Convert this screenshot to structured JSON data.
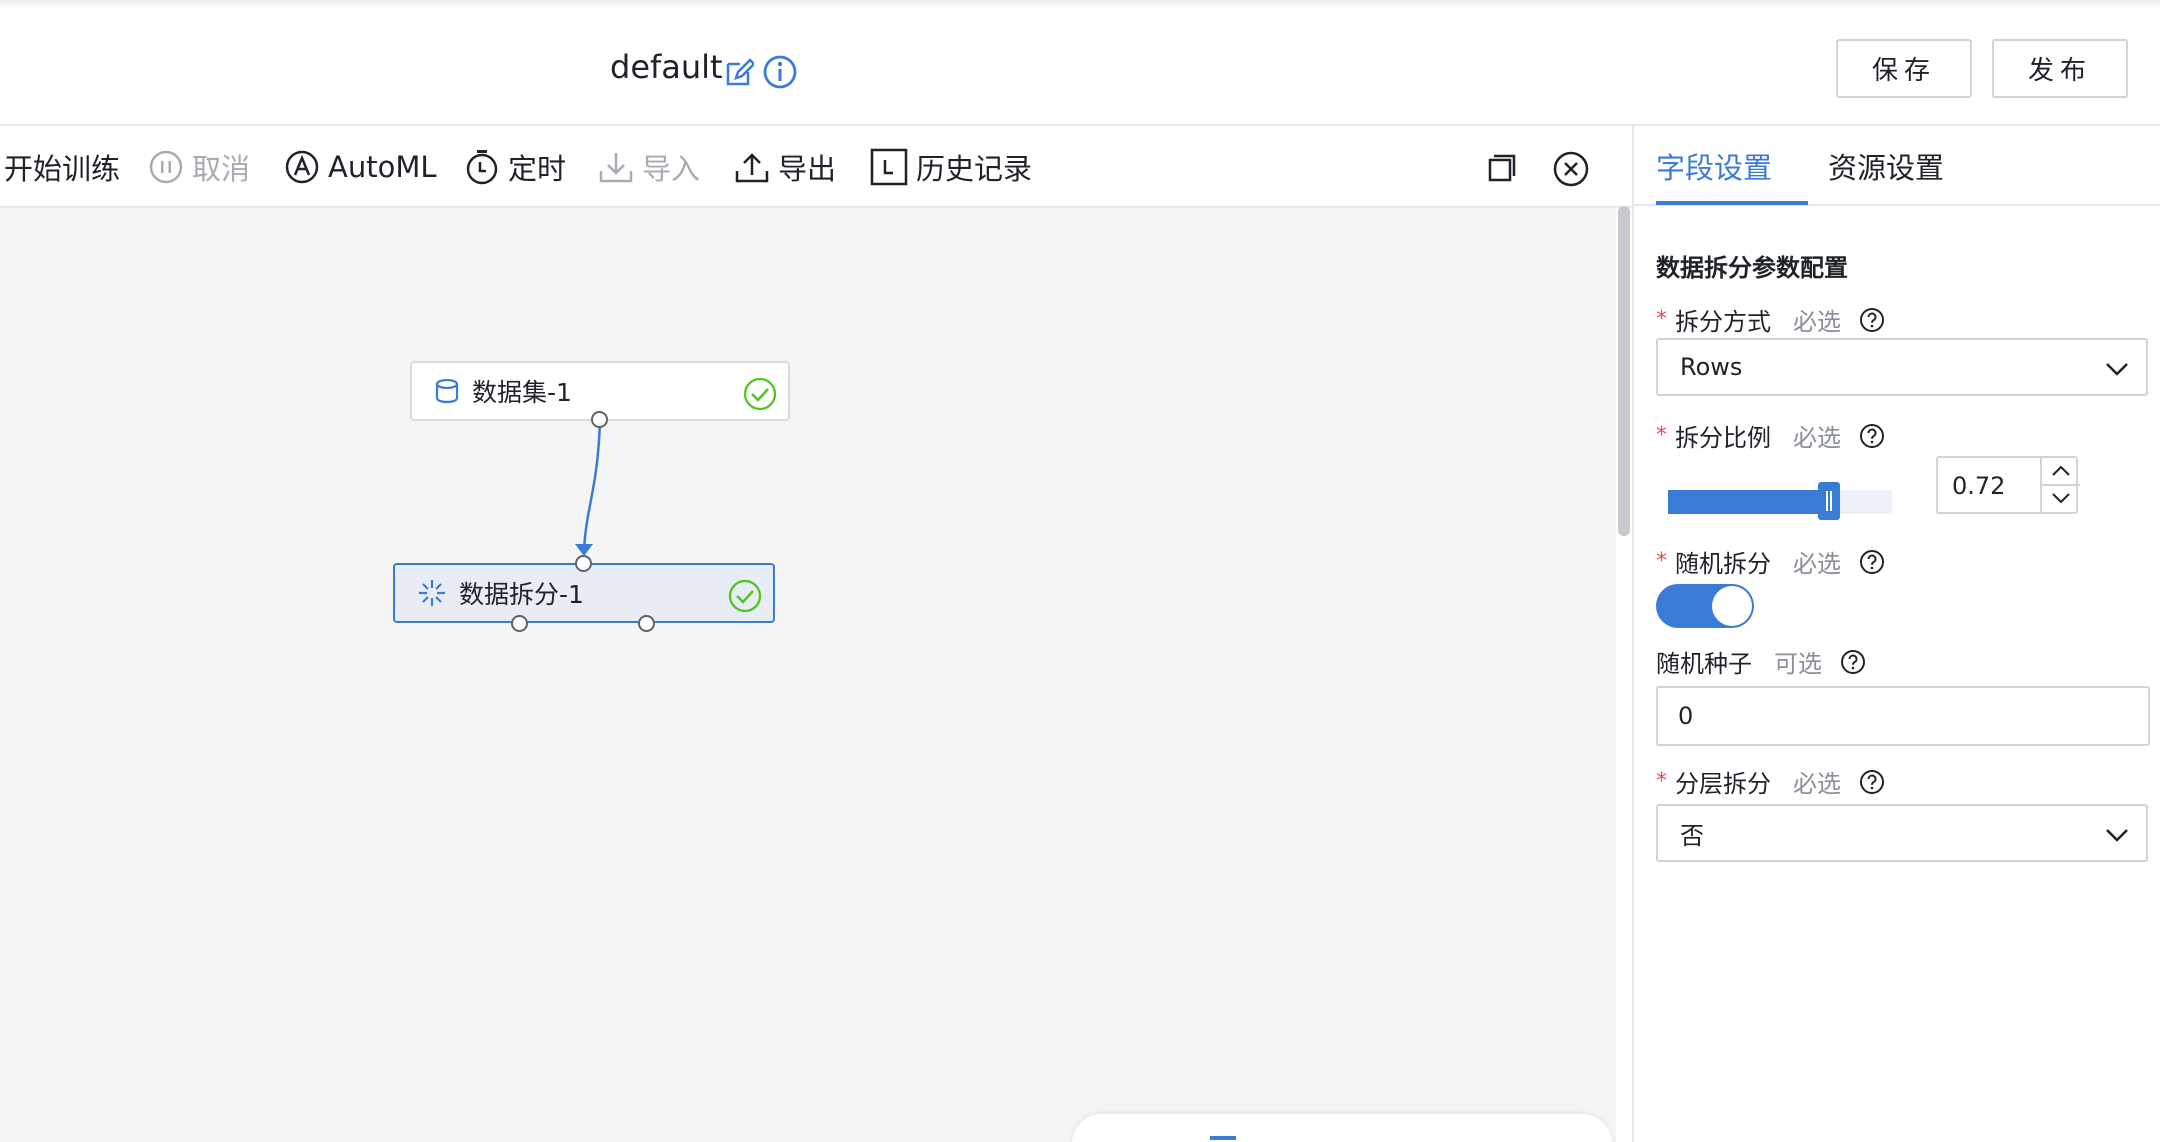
{
  "header": {
    "title": "default",
    "save_label": "保存",
    "publish_label": "发布"
  },
  "toolbar": {
    "start_training": "开始训练",
    "cancel": "取消",
    "automl": "AutoML",
    "schedule": "定时",
    "import": "导入",
    "export": "导出",
    "history": "历史记录"
  },
  "canvas": {
    "nodes": [
      {
        "label": "数据集-1",
        "icon": "database-icon",
        "status": "success"
      },
      {
        "label": "数据拆分-1",
        "icon": "split-icon",
        "status": "success",
        "selected": true
      }
    ]
  },
  "panel": {
    "tabs": [
      "字段设置",
      "资源设置"
    ],
    "active_tab": 0,
    "section_title": "数据拆分参数配置",
    "fields": {
      "split_method": {
        "label": "拆分方式",
        "hint": "必选",
        "value": "Rows"
      },
      "split_ratio": {
        "label": "拆分比例",
        "hint": "必选",
        "value": "0.72",
        "slider_fraction": 0.72
      },
      "random_split": {
        "label": "随机拆分",
        "hint": "必选",
        "on": true
      },
      "random_seed": {
        "label": "随机种子",
        "hint": "可选",
        "value": "0"
      },
      "stratified_split": {
        "label": "分层拆分",
        "hint": "必选",
        "value": "否"
      }
    }
  },
  "colors": {
    "accent": "#3a7bd5",
    "success": "#52c41a",
    "required": "#e34d59",
    "disabled": "#a8abb2"
  }
}
